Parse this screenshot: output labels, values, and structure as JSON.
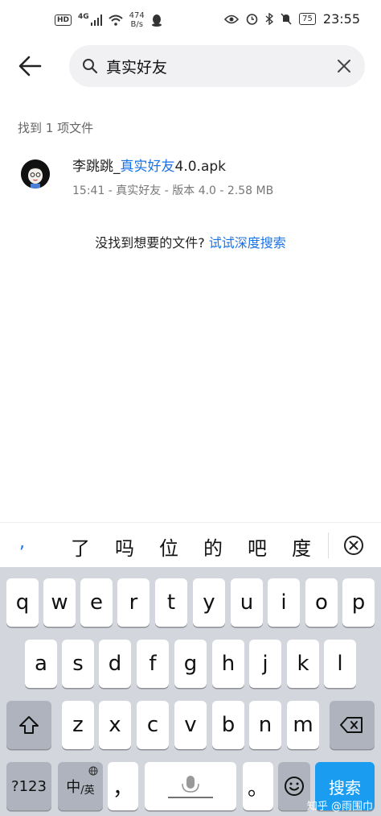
{
  "status_bar": {
    "hd": "HD",
    "network": "4G",
    "speed_value": "474",
    "speed_unit": "B/s",
    "battery": "75",
    "time": "23:55"
  },
  "search": {
    "query": "真实好友",
    "back_icon": "back-arrow-icon",
    "search_icon": "search-icon",
    "clear_icon": "clear-icon"
  },
  "results": {
    "found_label": "找到 1 项文件",
    "items": [
      {
        "name_prefix": "李跳跳_",
        "name_highlight": "真实好友",
        "name_suffix": "4.0.apk",
        "meta": "15:41 - 真实好友 - 版本 4.0 - 2.58 MB"
      }
    ]
  },
  "not_found": {
    "text": "没找到想要的文件?",
    "link": "试试深度搜索"
  },
  "candidates": [
    ",",
    "了",
    "吗",
    "位",
    "的",
    "吧",
    "度"
  ],
  "keyboard": {
    "row1": [
      "q",
      "w",
      "e",
      "r",
      "t",
      "y",
      "u",
      "i",
      "o",
      "p"
    ],
    "row2": [
      "a",
      "s",
      "d",
      "f",
      "g",
      "h",
      "j",
      "k",
      "l"
    ],
    "row3": [
      "z",
      "x",
      "c",
      "v",
      "b",
      "n",
      "m"
    ],
    "num_key": "?123",
    "lang_key_main": "中",
    "lang_key_sub": "/英",
    "comma_key": "，",
    "period_key": "。",
    "search_key": "搜索"
  },
  "watermark": "知乎 @雨围巾",
  "colors": {
    "accent": "#1a73e8",
    "search_key": "#1a9cf0",
    "keyboard_bg": "#d3d6dd"
  }
}
